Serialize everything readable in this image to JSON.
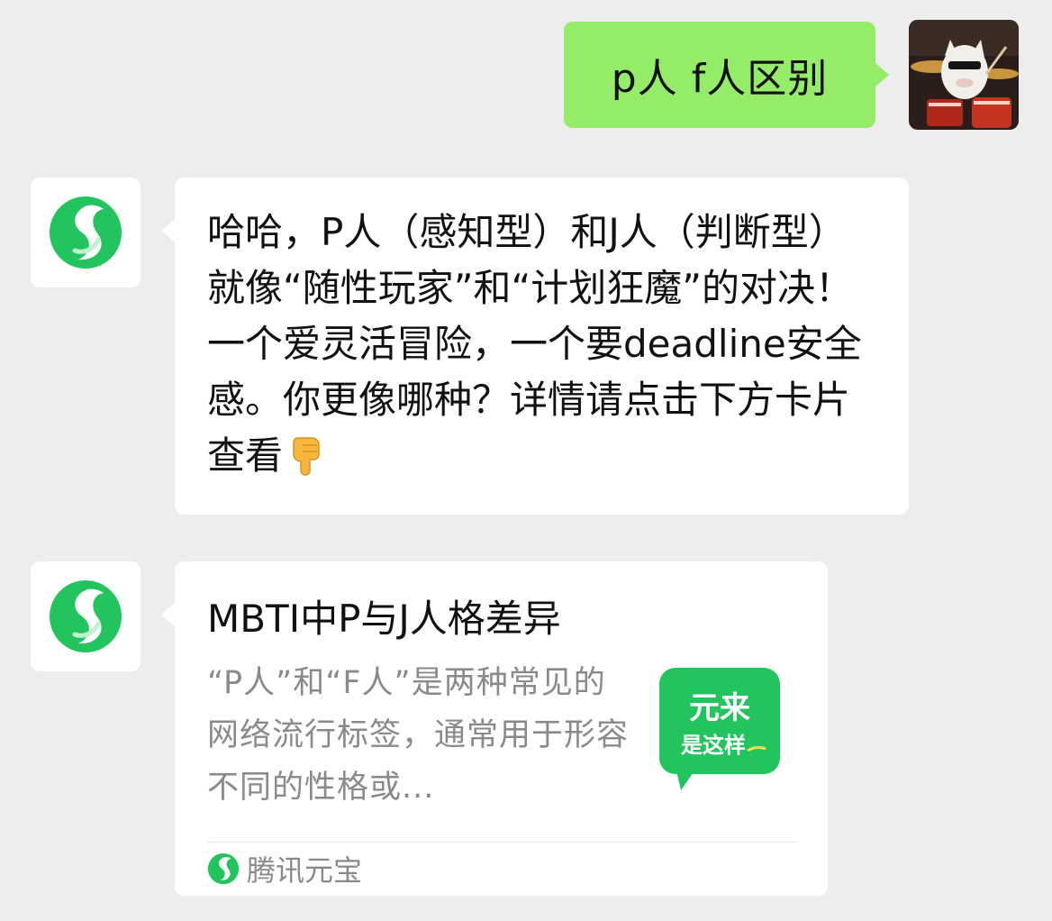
{
  "conversation": {
    "user_message": "p人 f人区别",
    "reply": {
      "text": "哈哈，P人（感知型）和J人（判断型）就像“随性玩家”和“计划狂魔”的对决！一个爱灵活冒险，一个要deadline安全感。你更像哪种？详情请点击下方卡片查看",
      "emoji_icon": "backhand-index-pointing-down-icon"
    },
    "card": {
      "title": "MBTI中P与J人格差异",
      "description": "“P人”和“F人”是两种常见的网络流行标签，通常用于形容不同的性格或...",
      "thumbnail_line1": "元来",
      "thumbnail_line2": "是这样",
      "source": "腾讯元宝"
    }
  },
  "colors": {
    "background": "#ededed",
    "outgoing_bubble": "#95ec69",
    "incoming_bubble": "#ffffff",
    "brand_green": "#22c45e",
    "secondary_text": "#8a8a8a"
  },
  "icons": {
    "user_avatar": "cat-drummer-avatar",
    "bot_avatar": "yuanbao-logo-icon",
    "source_logo": "yuanbao-logo-icon"
  }
}
